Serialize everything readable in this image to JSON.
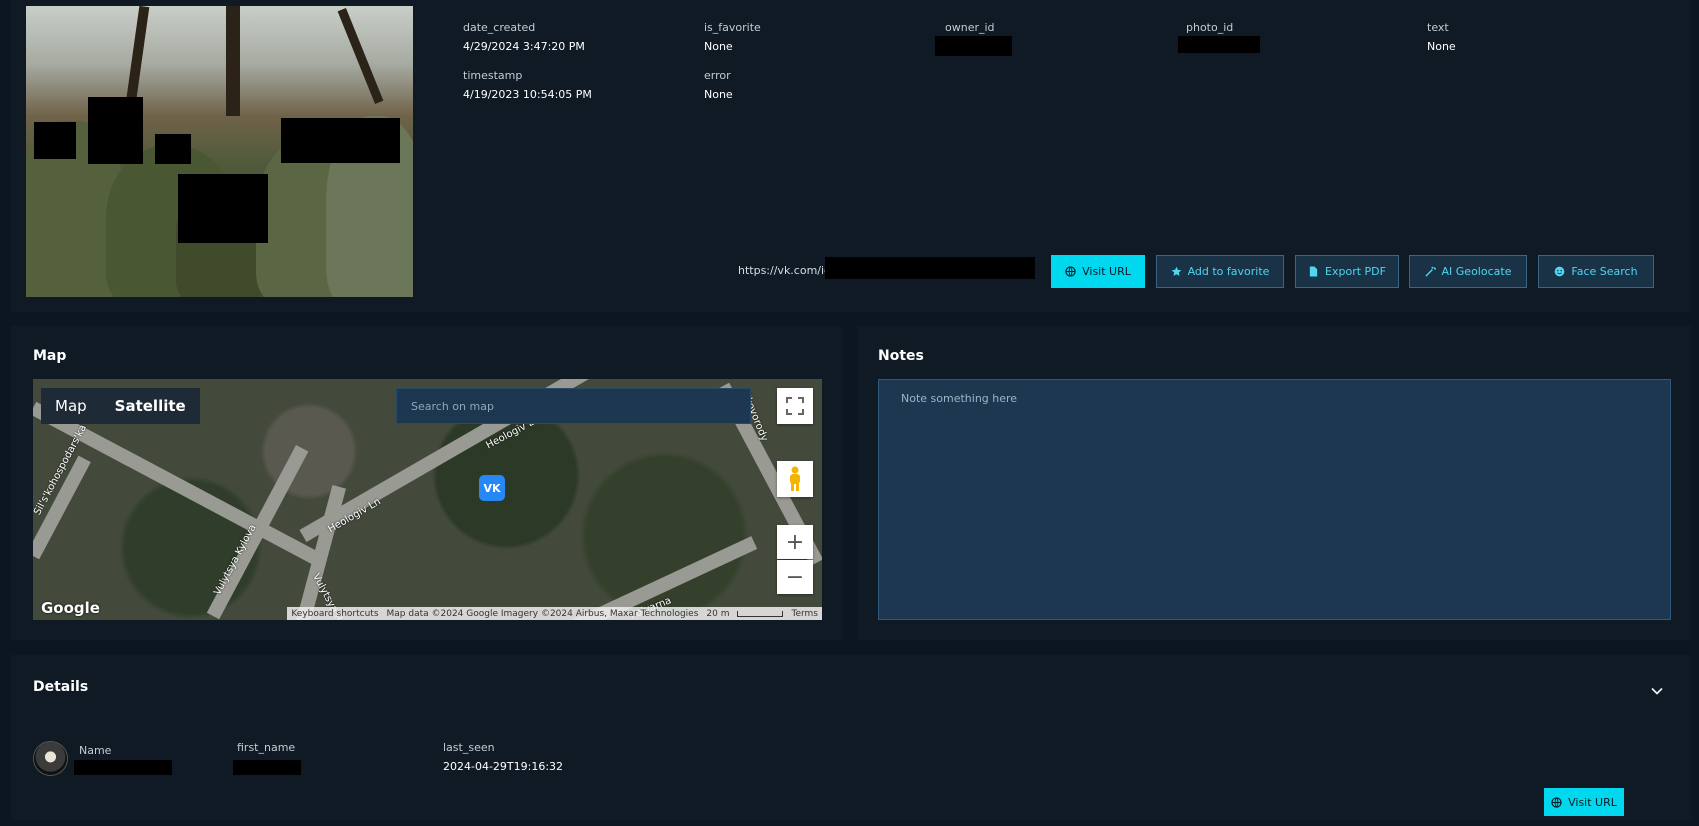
{
  "record": {
    "fields_row1": [
      {
        "label": "date_created",
        "value": "4/29/2024 3:47:20 PM"
      },
      {
        "label": "is_favorite",
        "value": "None"
      },
      {
        "label": "owner_id",
        "value": ""
      },
      {
        "label": "photo_id",
        "value": ""
      },
      {
        "label": "text",
        "value": "None"
      }
    ],
    "fields_row2": [
      {
        "label": "timestamp",
        "value": "4/19/2023 10:54:05 PM"
      },
      {
        "label": "error",
        "value": "None"
      }
    ],
    "url_prefix": "https://vk.com/id"
  },
  "actions": {
    "visit_url": "Visit URL",
    "add_favorite": "Add to favorite",
    "export_pdf": "Export PDF",
    "ai_geolocate": "AI Geolocate",
    "face_search": "Face Search"
  },
  "map_panel": {
    "title": "Map",
    "map_type_map": "Map",
    "map_type_satellite": "Satellite",
    "search_placeholder": "Search on map",
    "marker_label": "VK",
    "roads": [
      "Heologiv Ln",
      "Heologiv Ln",
      "Vulytsya Kylova",
      "Vulytsya Rob",
      "Sil's'kohospodars'ka",
      "Polyarna",
      "Skovorody"
    ],
    "google_logo": "Google",
    "footer_shortcuts": "Keyboard shortcuts",
    "footer_data": "Map data ©2024 Google Imagery ©2024 Airbus, Maxar Technologies",
    "footer_scale": "20 m",
    "footer_terms": "Terms"
  },
  "notes_panel": {
    "title": "Notes",
    "placeholder": "Note something here"
  },
  "details_panel": {
    "title": "Details",
    "name_label": "Name",
    "first_name_label": "first_name",
    "last_seen_label": "last_seen",
    "last_seen_value": "2024-04-29T19:16:32",
    "visit_url": "Visit URL"
  },
  "colors": {
    "accent": "#00d8f0",
    "background": "#0b1620",
    "panel": "#0f1a24",
    "button_bg": "#1a3246"
  }
}
